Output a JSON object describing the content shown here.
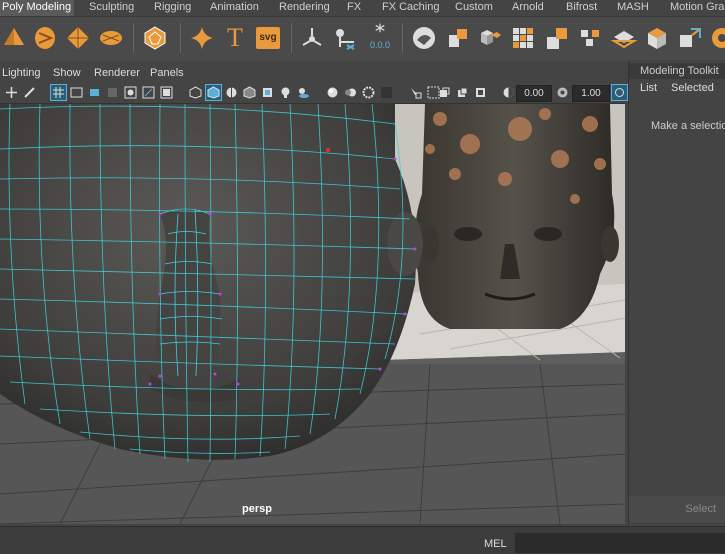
{
  "shelf": {
    "tabs": [
      "Poly Modeling",
      "Sculpting",
      "Rigging",
      "Animation",
      "Rendering",
      "FX",
      "FX Caching",
      "Custom",
      "Arnold",
      "Bifrost",
      "MASH",
      "Motion Grap"
    ],
    "active_tab": "Poly Modeling",
    "svg_label": "svg",
    "text_label": "T",
    "numbers_label": "0.0.0"
  },
  "panel_menu": [
    "Lighting",
    "Show",
    "Renderer",
    "Panels"
  ],
  "toolbar": {
    "field_a": "0.00",
    "field_b": "1.00"
  },
  "viewport": {
    "camera_label": "persp"
  },
  "modeling_toolkit": {
    "title": "Modeling Toolkit",
    "menu": [
      "List",
      "Selected"
    ],
    "hint": "Make a selection",
    "select_label": "Select"
  },
  "status": {
    "mel_label": "MEL"
  },
  "colors": {
    "accent": "#5ab0d8",
    "wire": "#3fd0e0",
    "vertex": "#c040e0",
    "tool_orange": "#e89a3c"
  }
}
